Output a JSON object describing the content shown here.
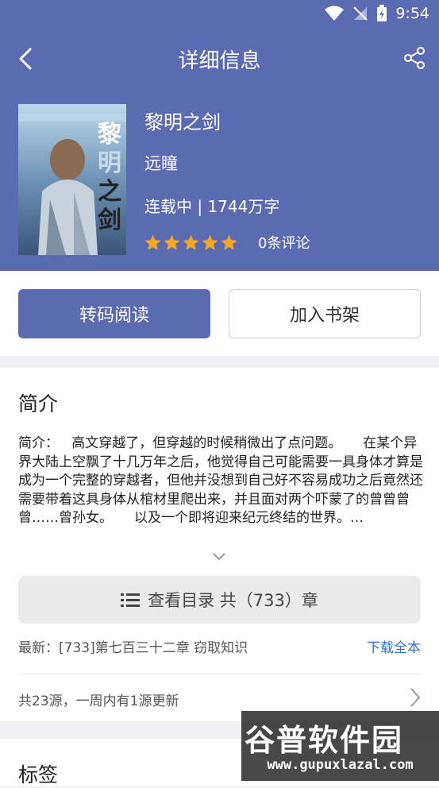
{
  "status_bar": {
    "time": "9:54"
  },
  "topbar": {
    "title": "详细信息"
  },
  "book": {
    "title": "黎明之剑",
    "author": "远瞳",
    "status": "连载中 | 1744万字",
    "rating_stars": 5,
    "comments": "0条评论"
  },
  "actions": {
    "read_label": "转码阅读",
    "shelf_label": "加入书架"
  },
  "intro": {
    "heading": "简介",
    "text": "简介：   高文穿越了，但穿越的时候稍微出了点问题。     在某个异界大陆上空飘了十几万年之后，他觉得自己可能需要一具身体才算是成为一个完整的穿越者，但他并没想到自己好不容易成功之后竟然还需要带着这具身体从棺材里爬出来，并且面对两个吓蒙了的曾曾曾曾……曾孙女。     以及一个即将迎来纪元终结的世界。…",
    "toc_label": "查看目录 共（733）章",
    "latest": "最新：[733]第七百三十二章 窃取知识",
    "download_label": "下载全本",
    "sources": "共23源，一周内有1源更新"
  },
  "tags": {
    "heading": "标签"
  },
  "watermark": {
    "main": "谷普软件园",
    "url": "www.gupuxlazal.com"
  },
  "colors": {
    "primary": "#5b6bb2",
    "link": "#2e6fd1",
    "star": "#f5a623"
  }
}
